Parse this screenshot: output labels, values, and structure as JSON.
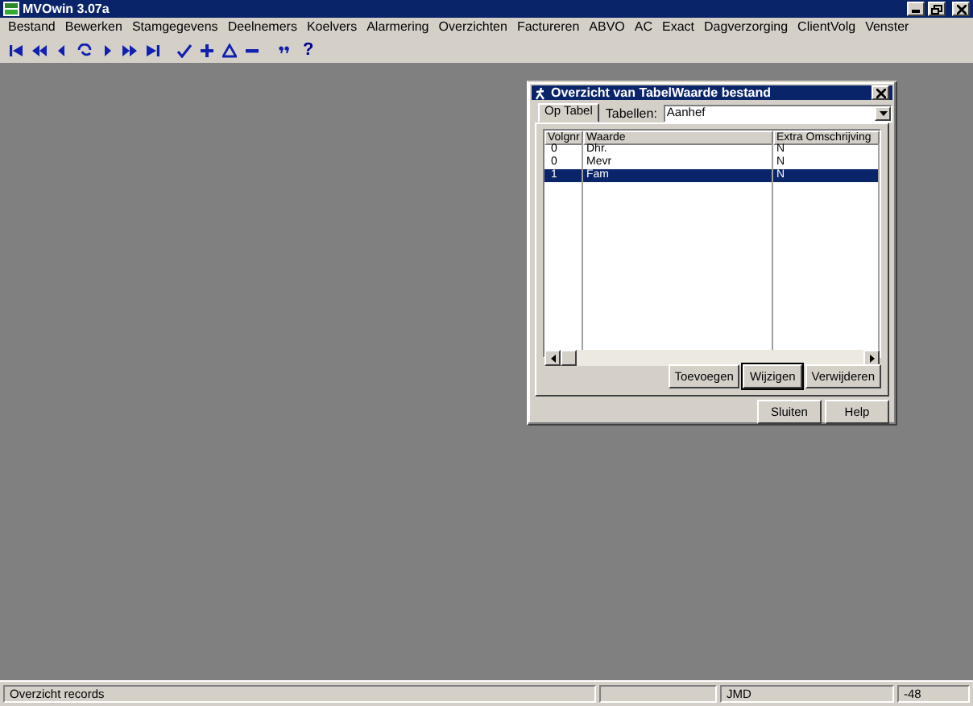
{
  "window": {
    "title": "MVOwin 3.07a"
  },
  "menu": [
    "Bestand",
    "Bewerken",
    "Stamgegevens",
    "Deelnemers",
    "Koelvers",
    "Alarmering",
    "Overzichten",
    "Factureren",
    "ABVO",
    "AC",
    "Exact",
    "Dagverzorging",
    "ClientVolg",
    "Venster"
  ],
  "toolbar": {
    "help_glyph": "?"
  },
  "dialog": {
    "title": "Overzicht van TabelWaarde bestand",
    "tabs": [
      {
        "label": "Op Tabel",
        "selected": true
      }
    ],
    "table_label": "Tabellen:",
    "table_value": "Aanhef",
    "columns": [
      "Volgnr",
      "Waarde",
      "Extra Omschrijving"
    ],
    "rows": [
      {
        "cells": [
          "0",
          "Dhr.",
          "N"
        ],
        "selected": false
      },
      {
        "cells": [
          "0",
          "Mevr",
          "N"
        ],
        "selected": false
      },
      {
        "cells": [
          "1",
          "Fam",
          "N"
        ],
        "selected": true
      }
    ],
    "list_buttons": [
      {
        "label": "Toevoegen",
        "default": false
      },
      {
        "label": "Wijzigen",
        "default": true
      },
      {
        "label": "Verwijderen",
        "default": false
      }
    ],
    "footer_buttons": [
      "Sluiten",
      "Help"
    ]
  },
  "status_bar": [
    "Overzicht records",
    "JMD",
    "-48"
  ]
}
